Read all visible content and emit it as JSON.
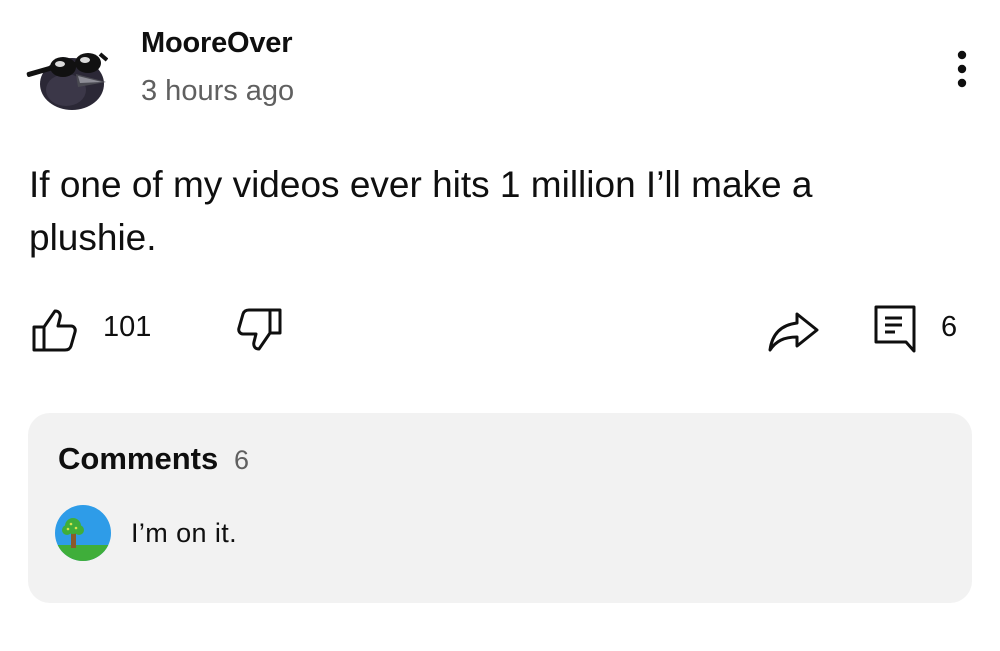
{
  "post": {
    "author": "MooreOver",
    "timestamp": "3 hours ago",
    "text": "If one of my videos ever hits 1 million I’ll make a plushie."
  },
  "actions": {
    "like_count": "101",
    "comment_count": "6",
    "icons": [
      "thumbs-up-icon",
      "thumbs-down-icon",
      "share-icon",
      "comment-icon",
      "more-vertical-icon"
    ]
  },
  "comments": {
    "title": "Comments",
    "count": "6",
    "top_comment": {
      "text": "I’m on it."
    }
  },
  "colors": {
    "text_primary": "#0f0f0f",
    "text_secondary": "#606060",
    "panel_background": "#f2f2f2",
    "commenter_avatar_sky": "#2e9ce8",
    "commenter_avatar_grass": "#3fae3a"
  }
}
